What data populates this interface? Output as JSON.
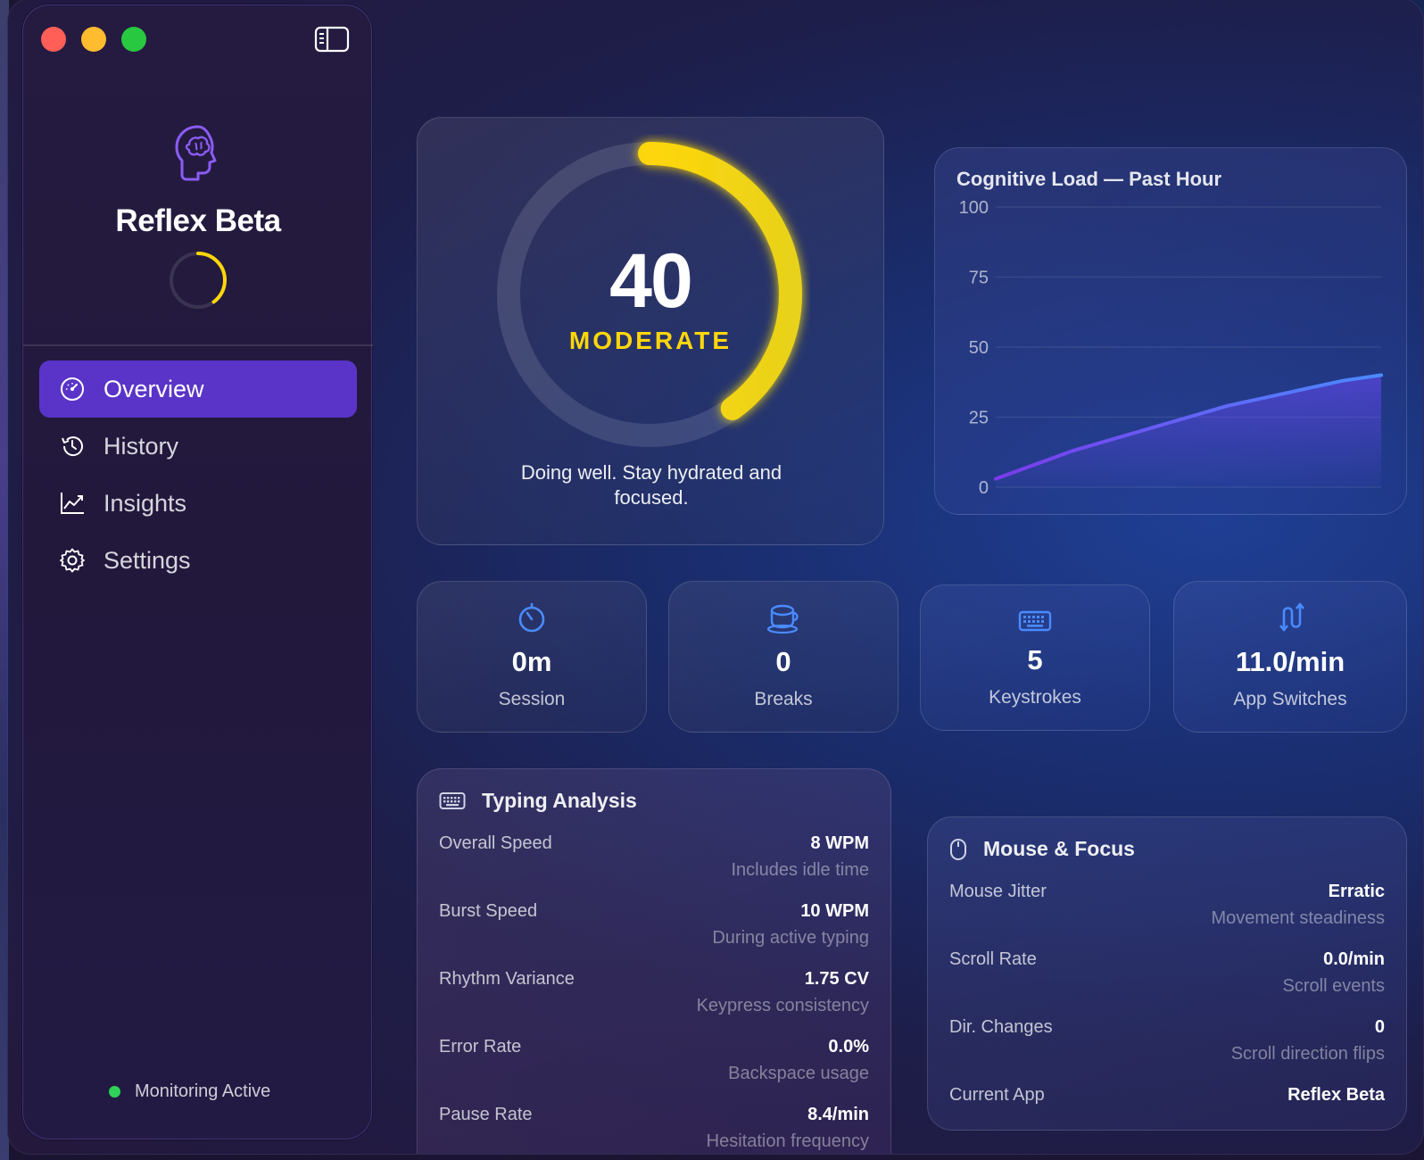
{
  "app": {
    "title": "Reflex Beta",
    "status": "Monitoring Active"
  },
  "sidebar": {
    "items": [
      {
        "label": "Overview",
        "icon": "gauge-icon",
        "active": true
      },
      {
        "label": "History",
        "icon": "history-icon",
        "active": false
      },
      {
        "label": "Insights",
        "icon": "chart-line-icon",
        "active": false
      },
      {
        "label": "Settings",
        "icon": "gear-icon",
        "active": false
      }
    ]
  },
  "gauge": {
    "value": "40",
    "level": "MODERATE",
    "fraction": 0.4,
    "message": "Doing well. Stay hydrated and focused.",
    "color": "#ffd60a"
  },
  "chart_data": {
    "type": "area",
    "title": "Cognitive Load — Past Hour",
    "ylim": [
      0,
      100
    ],
    "yticks": [
      0,
      25,
      50,
      75,
      100
    ],
    "grid": true,
    "series": [
      {
        "values": [
          3,
          8,
          13,
          17,
          21,
          25,
          29,
          32,
          35,
          38,
          40
        ],
        "color": "#7c5cff"
      }
    ]
  },
  "stats": [
    {
      "value": "0m",
      "label": "Session",
      "icon": "timer-icon"
    },
    {
      "value": "0",
      "label": "Breaks",
      "icon": "coffee-cup-icon"
    },
    {
      "value": "5",
      "label": "Keystrokes",
      "icon": "keyboard-icon"
    },
    {
      "value": "11.0/min",
      "label": "App Switches",
      "icon": "switch-arrows-icon"
    }
  ],
  "typing": {
    "title": "Typing Analysis",
    "metrics": [
      {
        "name": "Overall Speed",
        "value": "8 WPM",
        "sub": "Includes idle time"
      },
      {
        "name": "Burst Speed",
        "value": "10 WPM",
        "sub": "During active typing"
      },
      {
        "name": "Rhythm Variance",
        "value": "1.75 CV",
        "sub": "Keypress consistency"
      },
      {
        "name": "Error Rate",
        "value": "0.0%",
        "sub": "Backspace usage"
      },
      {
        "name": "Pause Rate",
        "value": "8.4/min",
        "sub": "Hesitation frequency"
      }
    ]
  },
  "mouse": {
    "title": "Mouse & Focus",
    "metrics": [
      {
        "name": "Mouse Jitter",
        "value": "Erratic",
        "sub": "Movement steadiness"
      },
      {
        "name": "Scroll Rate",
        "value": "0.0/min",
        "sub": "Scroll events"
      },
      {
        "name": "Dir. Changes",
        "value": "0",
        "sub": "Scroll direction flips"
      },
      {
        "name": "Current App",
        "value": "Reflex Beta",
        "sub": ""
      }
    ]
  },
  "colors": {
    "accent": "#5a34c8",
    "gauge": "#ffd60a",
    "icon_blue": "#4a8bff",
    "brain": "#8b5cf6",
    "status_dot": "#30d158"
  }
}
